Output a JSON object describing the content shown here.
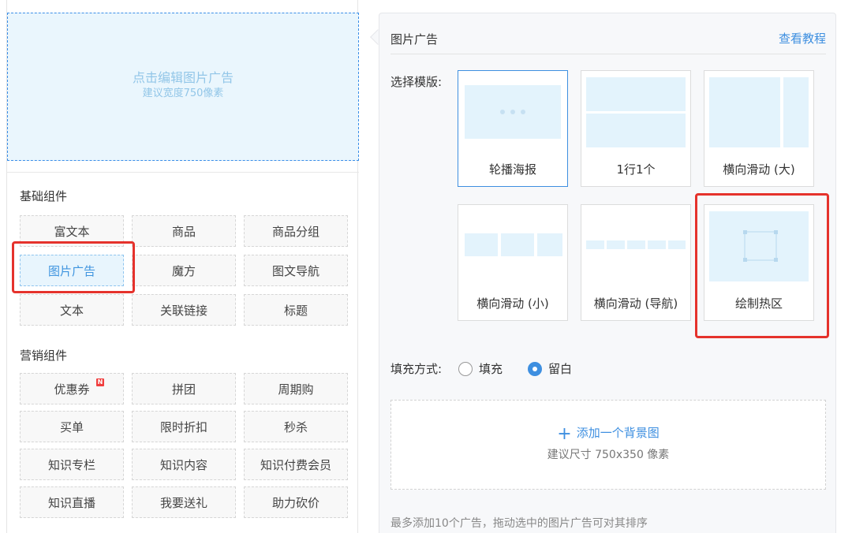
{
  "ad_preview": {
    "title": "点击编辑图片广告",
    "subtitle": "建议宽度750像素"
  },
  "basic_group": {
    "title": "基础组件",
    "items": [
      "富文本",
      "商品",
      "商品分组",
      "图片广告",
      "魔方",
      "图文导航",
      "文本",
      "关联链接",
      "标题"
    ]
  },
  "marketing_group": {
    "title": "营销组件",
    "items": [
      "优惠券",
      "拼团",
      "周期购",
      "买单",
      "限时折扣",
      "秒杀",
      "知识专栏",
      "知识内容",
      "知识付费会员",
      "知识直播",
      "我要送礼",
      "助力砍价"
    ],
    "badge": "N"
  },
  "panel": {
    "title": "图片广告",
    "tutorial_link": "查看教程",
    "template_label": "选择模版:",
    "templates": [
      "轮播海报",
      "1行1个",
      "横向滑动 (大)",
      "横向滑动 (小)",
      "横向滑动 (导航)",
      "绘制热区"
    ],
    "fill_label": "填充方式:",
    "fill_options": [
      "填充",
      "留白"
    ],
    "fill_selected": "留白",
    "add_bg": "添加一个背景图",
    "add_bg_icon": "plus-icon",
    "add_bg_hint": "建议尺寸 750x350 像素",
    "footer_note": "最多添加10个广告，拖动选中的图片广告可对其排序"
  },
  "colors": {
    "accent": "#3e8fe0",
    "highlight": "#e5322c",
    "badge": "#f03e3e"
  }
}
